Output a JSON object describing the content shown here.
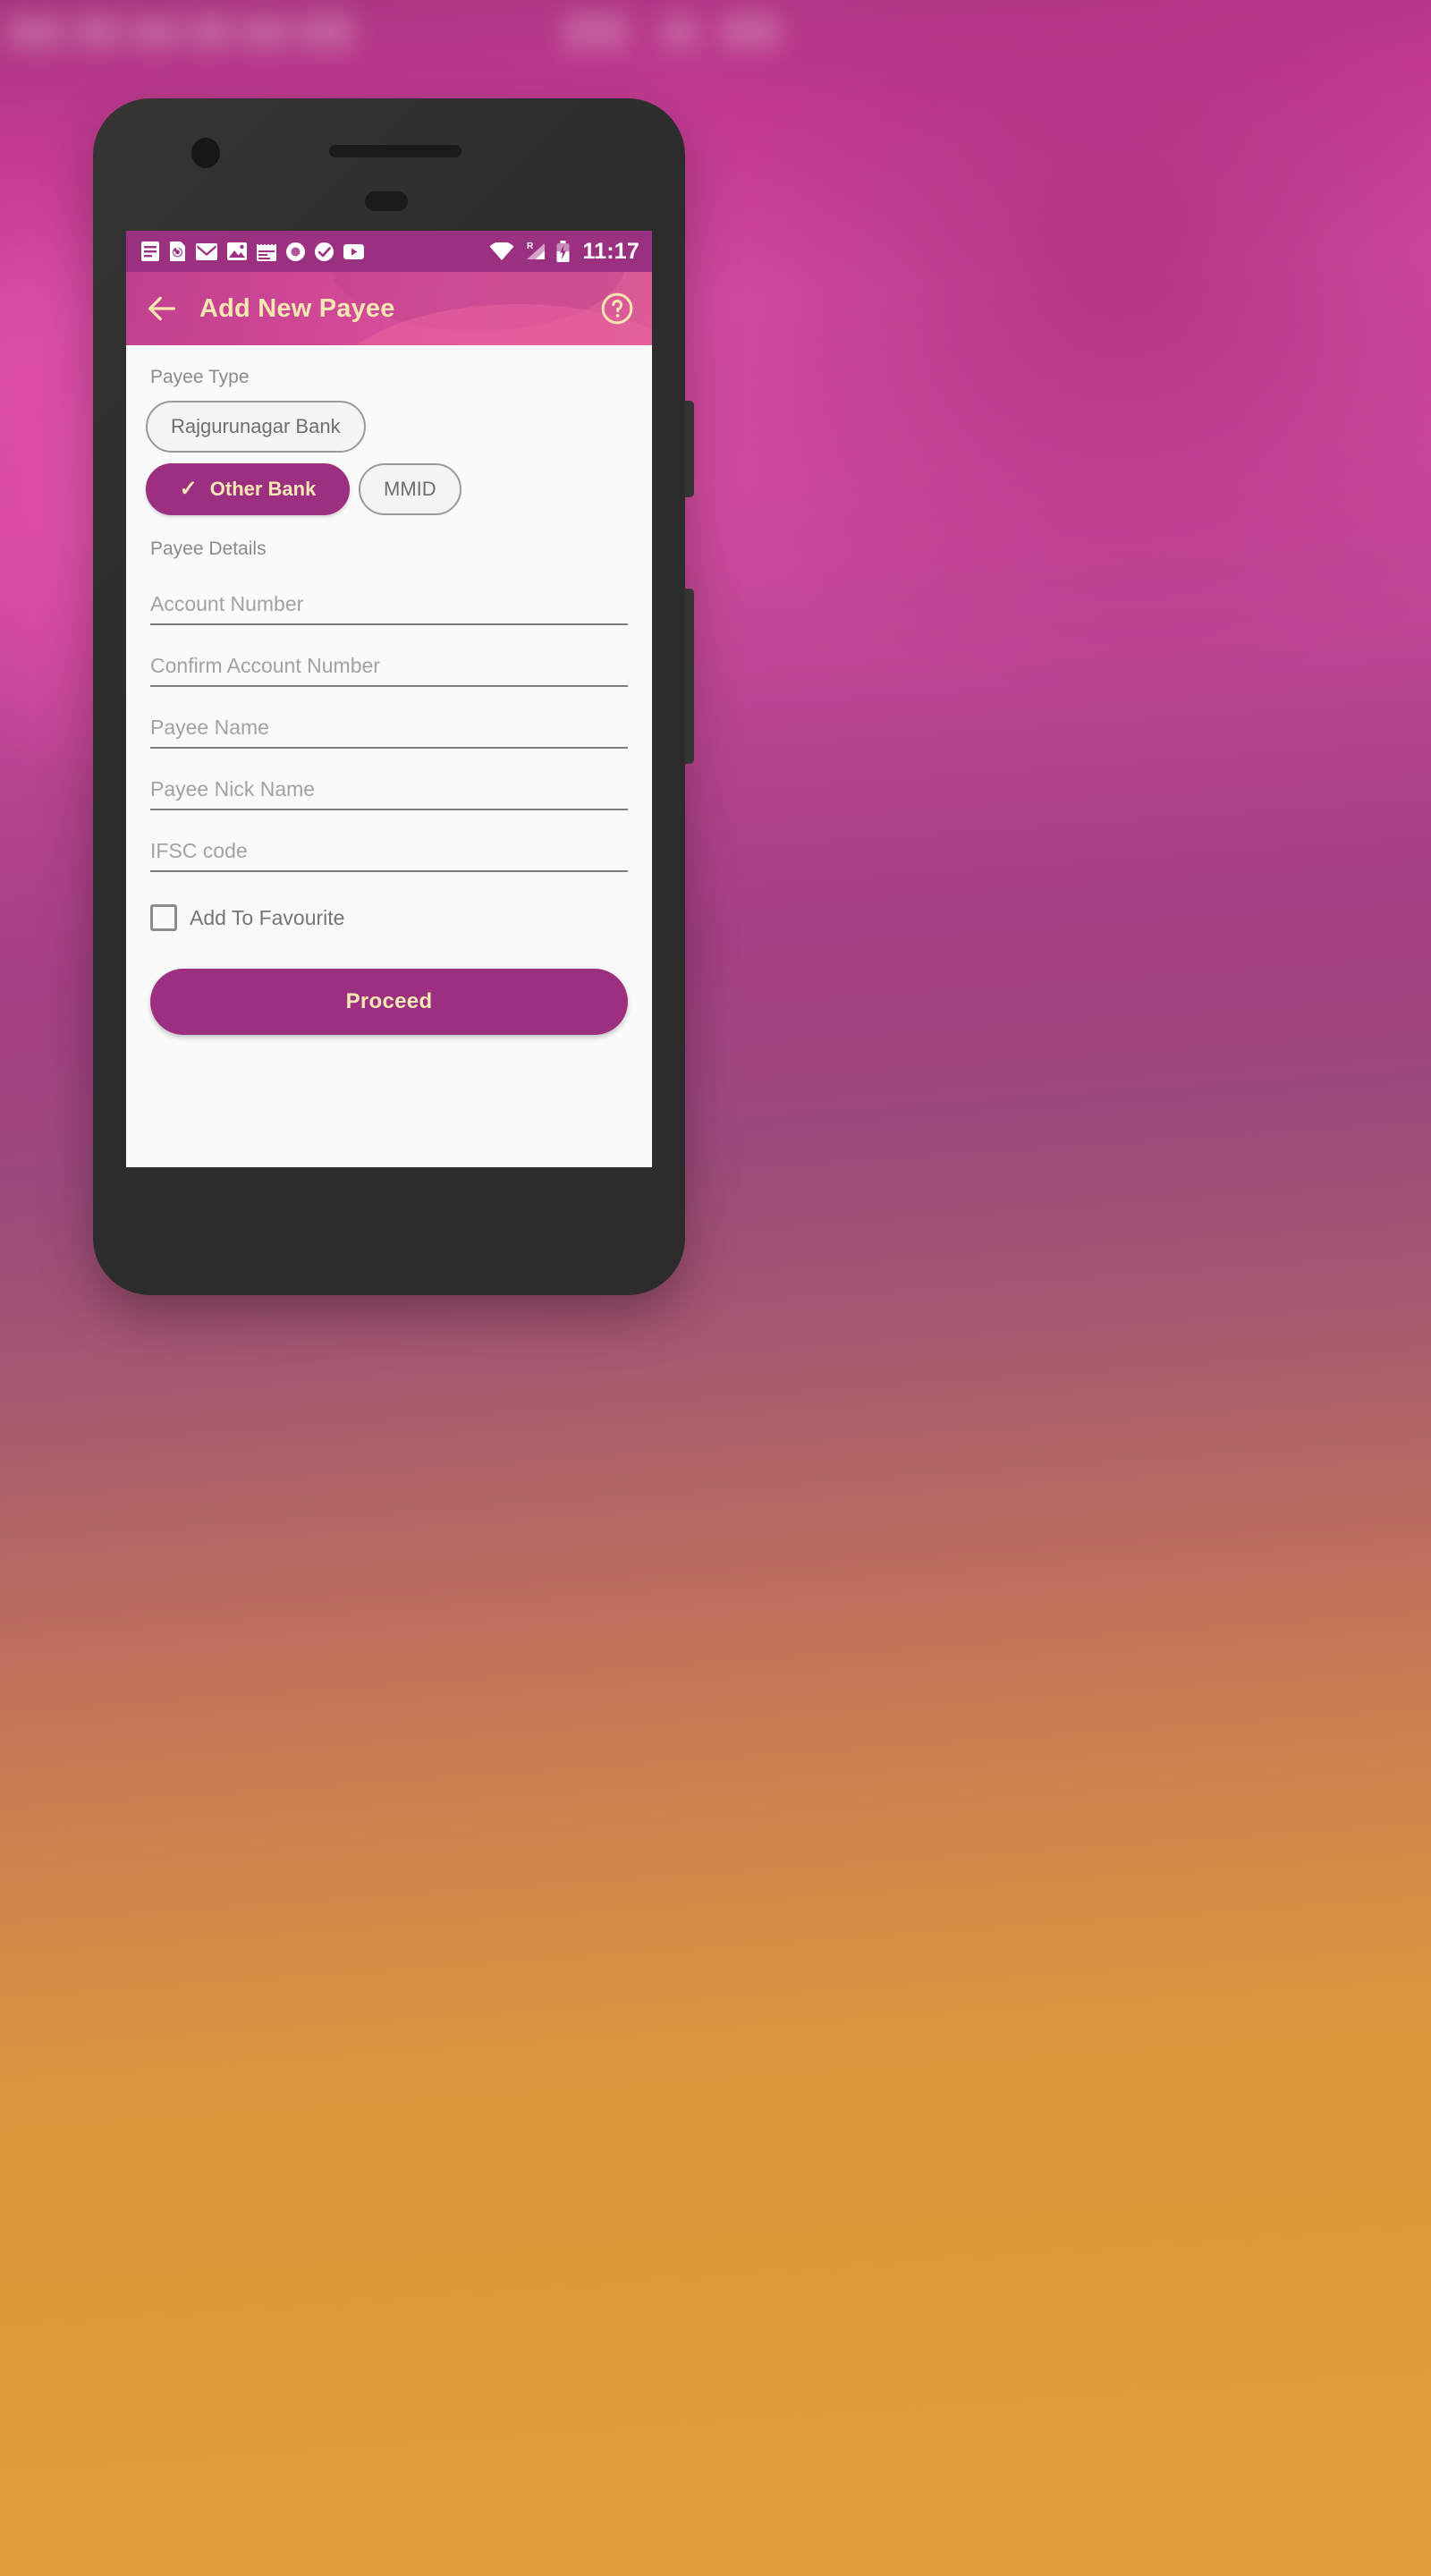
{
  "background": {
    "top_color": "#c53b93",
    "mid_color": "#a8486f",
    "bottom_color": "#e09c36"
  },
  "device": {
    "frame_color": "#2c2c2c",
    "camera_icon": "front-camera-icon",
    "earpiece_icon": "earpiece-speaker-icon"
  },
  "status_bar": {
    "background_color": "#9c3080",
    "time": "11:17",
    "notification_icons": [
      "document-list-icon",
      "drive-sync-icon",
      "gmail-icon",
      "photos-icon",
      "calendar-icon",
      "record-circle-icon",
      "check-circle-icon",
      "youtube-icon"
    ],
    "system_icons": [
      "wifi-icon",
      "cellular-signal-roaming-icon",
      "battery-charging-icon"
    ],
    "roaming_label": "R"
  },
  "app_bar": {
    "title": "Add New Payee",
    "back_icon": "back-arrow-icon",
    "help_icon": "help-circle-icon",
    "title_color": "#f7e6b0",
    "gradient_start": "#c0408f",
    "gradient_end": "#db5c96"
  },
  "payee_type": {
    "label": "Payee Type",
    "options": [
      {
        "label": "Rajgurunagar Bank",
        "selected": false
      },
      {
        "label": "Other Bank",
        "selected": true
      },
      {
        "label": "MMID",
        "selected": false
      }
    ],
    "selected_color": "#9c2f80",
    "selected_text_color": "#f8e7b4",
    "check_glyph": "✓"
  },
  "payee_details": {
    "label": "Payee Details",
    "fields": [
      {
        "placeholder": "Account Number",
        "value": ""
      },
      {
        "placeholder": "Confirm Account Number",
        "value": ""
      },
      {
        "placeholder": "Payee Name",
        "value": ""
      },
      {
        "placeholder": "Payee Nick Name",
        "value": ""
      },
      {
        "placeholder": "IFSC code",
        "value": ""
      }
    ]
  },
  "favourite": {
    "label": "Add To Favourite",
    "checked": false
  },
  "primary_action": {
    "label": "Proceed",
    "background_color": "#9c2f80",
    "text_color": "#f8e7b4"
  }
}
